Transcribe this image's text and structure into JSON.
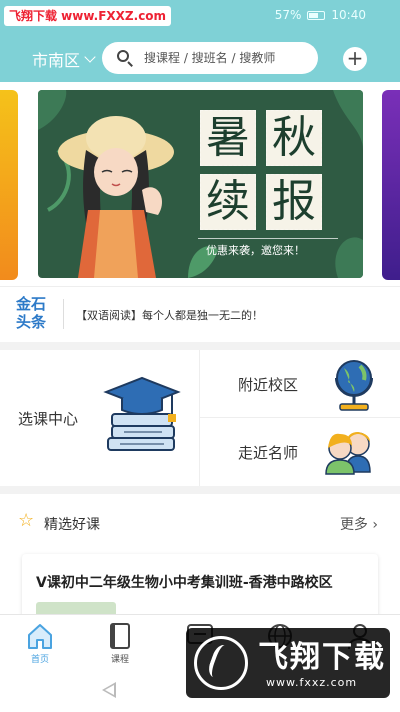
{
  "status_bar": {
    "watermark": "飞翔下载 www.FXXZ.com",
    "battery": "57%",
    "time": "10:40"
  },
  "header": {
    "city": "市南区",
    "search_placeholder": "搜课程 / 搜班名 / 搜教师",
    "add_icon": "plus-icon"
  },
  "banner": {
    "chars": [
      "暑",
      "秋",
      "续",
      "报"
    ],
    "tagline": "优惠来袭，邀您来！"
  },
  "news": {
    "logo_line1": "金石",
    "logo_line2": "头条",
    "text": "【双语阅读】每个人都是独一无二的！"
  },
  "categories": {
    "select_center": "选课中心",
    "nearby_campus": "附近校区",
    "famous_teachers": "走近名师"
  },
  "picks": {
    "title": "精选好课",
    "more": "更多",
    "course_title": "V课初中二年级生物小中考集训班-香港中路校区"
  },
  "tabs": [
    {
      "label": "首页",
      "icon": "home-icon",
      "active": true
    },
    {
      "label": "课程",
      "icon": "book-icon",
      "active": false
    },
    {
      "label": "",
      "icon": "message-icon",
      "active": false
    },
    {
      "label": "",
      "icon": "globe-icon",
      "active": false
    },
    {
      "label": "",
      "icon": "person-icon",
      "active": false
    }
  ],
  "watermark_bottom": {
    "text": "飞翔下载",
    "url": "www.fxxz.com"
  },
  "colors": {
    "header": "#7fd1d6",
    "active_tab": "#4aa3e0",
    "banner": "#2f5b43"
  }
}
